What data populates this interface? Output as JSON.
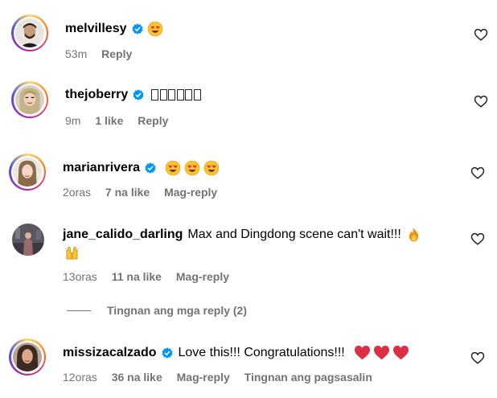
{
  "comments": [
    {
      "username": "melvillesy",
      "verified": true,
      "text": "",
      "emojis": [
        "heart-eyes"
      ],
      "time": "53m",
      "likes": "",
      "reply": "Reply",
      "extra": ""
    },
    {
      "username": "thejoberry",
      "verified": true,
      "text": "",
      "emojis": [],
      "time": "9m",
      "likes": "1 like",
      "reply": "Reply",
      "extra": ""
    },
    {
      "username": "marianrivera",
      "verified": true,
      "text": "",
      "emojis": [
        "heart-eyes",
        "heart-eyes",
        "heart-eyes"
      ],
      "time": "2oras",
      "likes": "7 na like",
      "reply": "Mag-reply",
      "extra": ""
    },
    {
      "username": "jane_calido_darling",
      "verified": false,
      "text": "Max and Dingdong scene can't wait!!!",
      "emojis": [
        "fire",
        "raised-hands"
      ],
      "time": "13oras",
      "likes": "11 na like",
      "reply": "Mag-reply",
      "extra": ""
    },
    {
      "username": "missizacalzado",
      "verified": true,
      "text": "Love this!!! Congratulations!!!",
      "emojis": [
        "red-heart",
        "red-heart",
        "red-heart"
      ],
      "time": "12oras",
      "likes": "36 na like",
      "reply": "Mag-reply",
      "extra": "Tingnan ang pagsasalin"
    }
  ],
  "view_replies": "Tingnan ang mga reply (2)",
  "colors": {
    "meta_text": "#737373",
    "verified_blue": "#0095f6",
    "heart_red": "#ed1c24"
  },
  "icons": {
    "like": "heart-outline-icon",
    "verified": "verified-badge-icon"
  }
}
